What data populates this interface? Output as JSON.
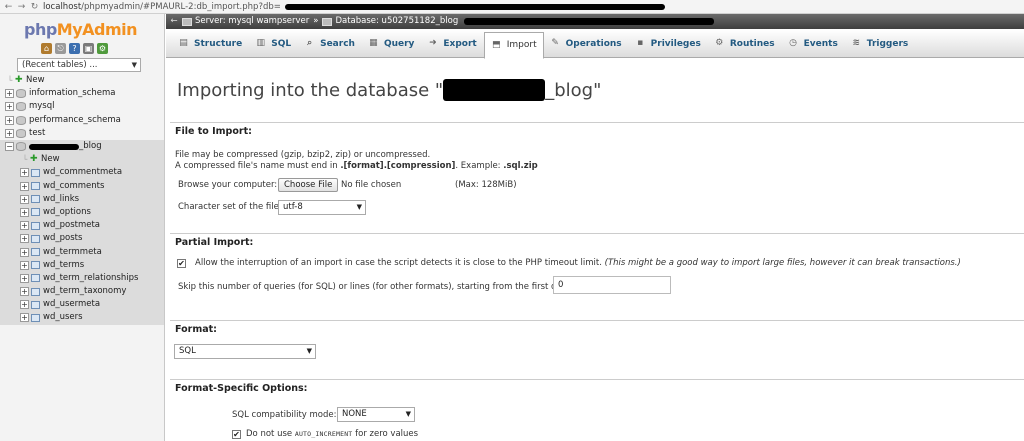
{
  "browser": {
    "back_glyph": "←",
    "forward_glyph": "→",
    "reload_glyph": "↻",
    "url_host": "localhost",
    "url_path": "/phpmyadmin/#PMAURL-2:db_import.php?db="
  },
  "sidebar": {
    "logo_part1": "php",
    "logo_part2": "MyAdmin",
    "quick_icons": [
      "home-icon",
      "exit-icon",
      "docs-icon",
      "sql-docs-icon",
      "settings-icon"
    ],
    "recent_tables": "(Recent tables) ...",
    "tree": [
      {
        "label": "New",
        "kind": "new",
        "level": 0
      },
      {
        "label": "information_schema",
        "kind": "db",
        "level": 0
      },
      {
        "label": "mysql",
        "kind": "db",
        "level": 0
      },
      {
        "label": "performance_schema",
        "kind": "db",
        "level": 0
      },
      {
        "label": "test",
        "kind": "db",
        "level": 0
      },
      {
        "label": "_blog",
        "kind": "db-open",
        "level": 0
      },
      {
        "label": "New",
        "kind": "new",
        "level": 1
      },
      {
        "label": "wd_commentmeta",
        "kind": "table",
        "level": 1
      },
      {
        "label": "wd_comments",
        "kind": "table",
        "level": 1
      },
      {
        "label": "wd_links",
        "kind": "table",
        "level": 1
      },
      {
        "label": "wd_options",
        "kind": "table",
        "level": 1
      },
      {
        "label": "wd_postmeta",
        "kind": "table",
        "level": 1
      },
      {
        "label": "wd_posts",
        "kind": "table",
        "level": 1
      },
      {
        "label": "wd_termmeta",
        "kind": "table",
        "level": 1
      },
      {
        "label": "wd_terms",
        "kind": "table",
        "level": 1
      },
      {
        "label": "wd_term_relationships",
        "kind": "table",
        "level": 1
      },
      {
        "label": "wd_term_taxonomy",
        "kind": "table",
        "level": 1
      },
      {
        "label": "wd_usermeta",
        "kind": "table",
        "level": 1
      },
      {
        "label": "wd_users",
        "kind": "table",
        "level": 1
      }
    ]
  },
  "breadcrumb": {
    "back": "←",
    "server": "Server: mysql wampserver",
    "sep": "»",
    "database": "Database: u502751182_blog"
  },
  "tabs": [
    {
      "label": "Structure",
      "icon": "structure-icon",
      "glyph": "▤"
    },
    {
      "label": "SQL",
      "icon": "sql-icon",
      "glyph": "▥"
    },
    {
      "label": "Search",
      "icon": "search-icon",
      "glyph": "⌕"
    },
    {
      "label": "Query",
      "icon": "query-icon",
      "glyph": "▦"
    },
    {
      "label": "Export",
      "icon": "export-icon",
      "glyph": "➜"
    },
    {
      "label": "Import",
      "icon": "import-icon",
      "glyph": "⬒"
    },
    {
      "label": "Operations",
      "icon": "wrench-icon",
      "glyph": "✎"
    },
    {
      "label": "Privileges",
      "icon": "privileges-icon",
      "glyph": "▪"
    },
    {
      "label": "Routines",
      "icon": "routines-icon",
      "glyph": "⚙"
    },
    {
      "label": "Events",
      "icon": "clock-icon",
      "glyph": "◷"
    },
    {
      "label": "Triggers",
      "icon": "triggers-icon",
      "glyph": "≋"
    }
  ],
  "active_tab": "Import",
  "page": {
    "title_prefix": "Importing into the database \"",
    "title_suffix": "_blog\""
  },
  "file_import": {
    "heading": "File to Import:",
    "compress_note": "File may be compressed (gzip, bzip2, zip) or uncompressed.",
    "name_note_prefix": "A compressed file's name must end in ",
    "name_note_format": ".[format].[compression]",
    "name_note_example": ". Example: ",
    "name_note_example_value": ".sql.zip",
    "browse_label": "Browse your computer:",
    "choose_button": "Choose File",
    "no_file": "No file chosen",
    "max_size": "(Max: 128MiB)",
    "charset_label": "Character set of the file:",
    "charset_value": "utf-8"
  },
  "partial_import": {
    "heading": "Partial Import:",
    "allow_interrupt": "Allow the interruption of an import in case the script detects it is close to the PHP timeout limit.",
    "allow_interrupt_note": "(This might be a good way to import large files, however it can break transactions.)",
    "allow_checked": "✔",
    "skip_label": "Skip this number of queries (for SQL) or lines (for other formats), starting from the first one:",
    "skip_value": "0"
  },
  "format": {
    "heading": "Format:",
    "value": "SQL"
  },
  "format_options": {
    "heading": "Format-Specific Options:",
    "compat_label": "SQL compatibility mode:",
    "compat_value": "NONE",
    "no_auto_prefix": "Do not use ",
    "no_auto_code": "AUTO_INCREMENT",
    "no_auto_suffix": " for zero values",
    "no_auto_checked": "✔"
  }
}
